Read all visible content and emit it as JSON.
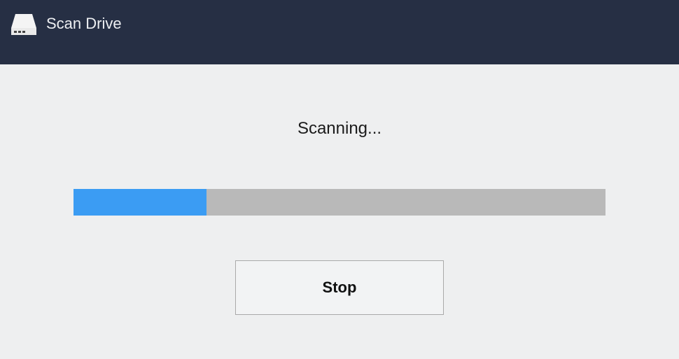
{
  "header": {
    "title": "Scan Drive",
    "icon_name": "drive-icon"
  },
  "main": {
    "status_text": "Scanning...",
    "progress_percent": 25,
    "stop_label": "Stop"
  },
  "colors": {
    "header_bg": "#262f44",
    "body_bg": "#eeeff0",
    "progress_track": "#b9b9b9",
    "progress_fill": "#3b9cf3"
  }
}
